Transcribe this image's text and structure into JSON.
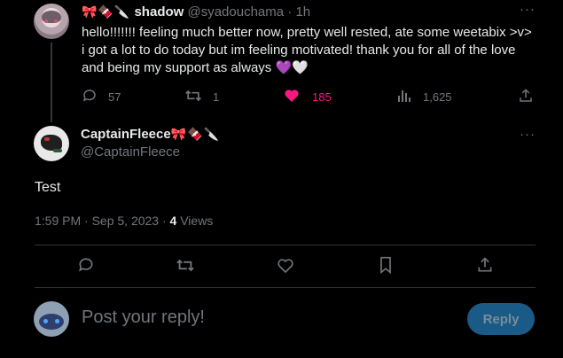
{
  "parent_tweet": {
    "display_name": "shadow",
    "name_emojis": "🎀🍫🔪",
    "handle": "@syadouchama",
    "separator": "·",
    "time_ago": "1h",
    "body": "hello!!!!!!! feeling much better now, pretty well rested, ate some weetabix >v> i got a lot to do today but im feeling motivated! thank you for all of the love and being my support as always 💜🤍",
    "actions": {
      "replies": "57",
      "retweets": "1",
      "likes": "185",
      "views": "1,625"
    },
    "accent_like_color": "#f91880"
  },
  "main_tweet": {
    "display_name": "CaptainFleece",
    "name_emojis": "🎀🍫🔪",
    "handle": "@CaptainFleece",
    "body": "Test",
    "timestamp": "1:59 PM · Sep 5, 2023 · ",
    "views_count": "4",
    "views_label": " Views"
  },
  "composer": {
    "placeholder": "Post your reply!",
    "reply_label": "Reply",
    "button_color": "#1a5a86"
  }
}
